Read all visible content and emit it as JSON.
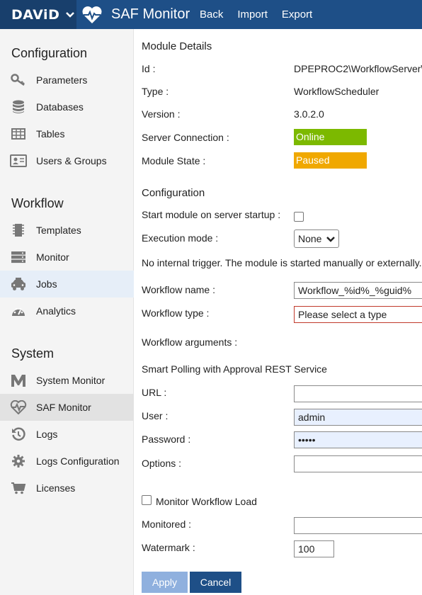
{
  "topbar": {
    "brand": "DAViD",
    "app_title": "SAF Monitor",
    "nav": [
      "Back",
      "Import",
      "Export"
    ]
  },
  "sidebar": {
    "sections": [
      {
        "title": "Configuration",
        "items": [
          {
            "label": "Parameters",
            "icon": "key-icon"
          },
          {
            "label": "Databases",
            "icon": "database-icon"
          },
          {
            "label": "Tables",
            "icon": "table-icon"
          },
          {
            "label": "Users & Groups",
            "icon": "id-card-icon"
          }
        ]
      },
      {
        "title": "Workflow",
        "items": [
          {
            "label": "Templates",
            "icon": "chip-icon"
          },
          {
            "label": "Monitor",
            "icon": "server-icon"
          },
          {
            "label": "Jobs",
            "icon": "taxi-icon"
          },
          {
            "label": "Analytics",
            "icon": "gauge-icon"
          }
        ]
      },
      {
        "title": "System",
        "items": [
          {
            "label": "System Monitor",
            "icon": "m-logo-icon"
          },
          {
            "label": "SAF Monitor",
            "icon": "heartbeat-icon"
          },
          {
            "label": "Logs",
            "icon": "history-icon"
          },
          {
            "label": "Logs Configuration",
            "icon": "gear-icon"
          },
          {
            "label": "Licenses",
            "icon": "cart-icon"
          }
        ]
      }
    ]
  },
  "details": {
    "heading": "Module Details",
    "id_label": "Id :",
    "id_value": "DPEPROC2\\WorkflowServer\\",
    "type_label": "Type :",
    "type_value": "WorkflowScheduler",
    "version_label": "Version :",
    "version_value": "3.0.2.0",
    "server_label": "Server Connection :",
    "server_value": "Online",
    "state_label": "Module State :",
    "state_value": "Paused"
  },
  "configuration": {
    "heading": "Configuration",
    "start_label": "Start module on server startup :",
    "exec_label": "Execution mode :",
    "exec_value": "None",
    "trigger_note": "No internal trigger. The module is started manually or externally.",
    "wf_name_label": "Workflow name :",
    "wf_name_value": "Workflow_%id%_%guid%",
    "wf_type_label": "Workflow type :",
    "wf_type_value": "Please select a type",
    "wf_args_label": "Workflow arguments :",
    "polling_heading": "Smart Polling with Approval REST Service",
    "url_label": "URL :",
    "url_value": "",
    "user_label": "User :",
    "user_value": "admin",
    "password_label": "Password :",
    "password_value": "•••••",
    "options_label": "Options :",
    "options_value": "",
    "monitor_load_label": "Monitor Workflow Load",
    "monitored_label": "Monitored :",
    "monitored_value": "",
    "watermark_label": "Watermark :",
    "watermark_value": "100"
  },
  "buttons": {
    "apply": "Apply",
    "cancel": "Cancel"
  },
  "colors": {
    "topbar": "#1e4f87",
    "online": "#7cb900",
    "paused": "#f0a800"
  }
}
